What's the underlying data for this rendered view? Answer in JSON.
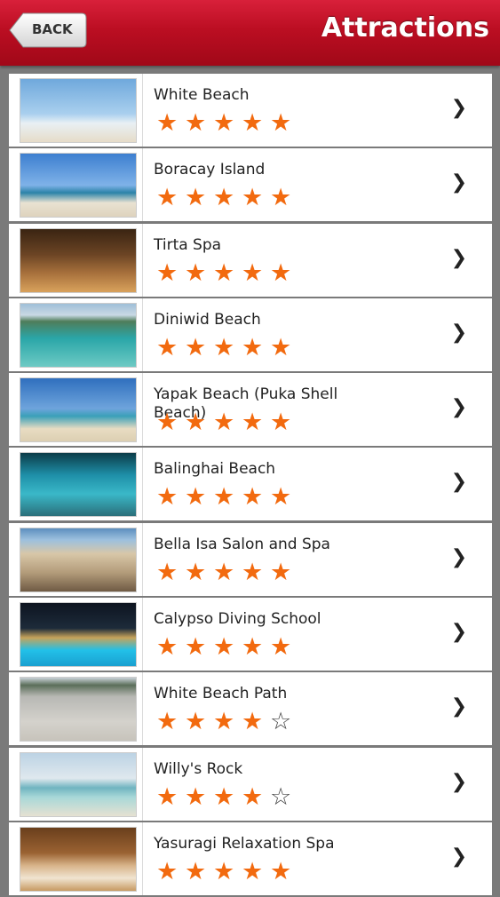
{
  "nav": {
    "back_label": "BACK",
    "title": "Attractions"
  },
  "items": [
    {
      "name": "White Beach",
      "rating": 5,
      "thumb": "palm-beach"
    },
    {
      "name": "Boracay Island",
      "rating": 5,
      "thumb": "leaning-palm"
    },
    {
      "name": "Tirta Spa",
      "rating": 5,
      "thumb": "spa-room"
    },
    {
      "name": "Diniwid Beach",
      "rating": 5,
      "thumb": "cove"
    },
    {
      "name": "Yapak Beach (Puka Shell Beach)",
      "rating": 5,
      "thumb": "shell-beach"
    },
    {
      "name": "Balinghai Beach",
      "rating": 5,
      "thumb": "reef"
    },
    {
      "name": "Bella Isa Salon and Spa",
      "rating": 5,
      "thumb": "rocky-shore"
    },
    {
      "name": "Calypso Diving School",
      "rating": 5,
      "thumb": "pool-night"
    },
    {
      "name": "White Beach Path",
      "rating": 4,
      "thumb": "sand-path"
    },
    {
      "name": "Willy's Rock",
      "rating": 4,
      "thumb": "rock-island"
    },
    {
      "name": "Yasuragi Relaxation Spa",
      "rating": 5,
      "thumb": "massage-room"
    }
  ],
  "icons": {
    "row_arrow": "chevron-right-icon",
    "star_full": "star-filled-icon",
    "star_empty": "star-outline-icon"
  },
  "colors": {
    "navbar": "#bb0e22",
    "star": "#f26a0f"
  }
}
